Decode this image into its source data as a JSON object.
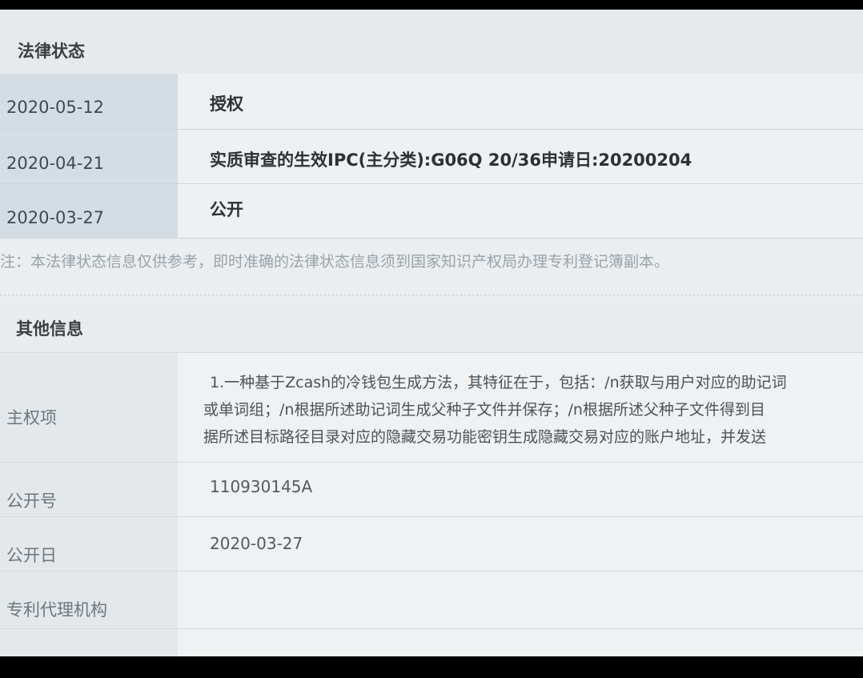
{
  "legal_status": {
    "title": "法律状态",
    "rows": [
      {
        "date": "2020-05-12",
        "status": "授权"
      },
      {
        "date": "2020-04-21",
        "status": "实质审查的生效IPC(主分类):G06Q 20/36申请日:20200204"
      },
      {
        "date": "2020-03-27",
        "status": "公开"
      }
    ],
    "note": "注：本法律状态信息仅供参考，即时准确的法律状态信息须到国家知识产权局办理专利登记簿副本。"
  },
  "other_info": {
    "title": "其他信息",
    "main_claim_label": "主权项",
    "main_claim_lines": [
      "1.一种基于Zcash的冷钱包生成方法，其特征在于，包括：/n获取与用户对应的助记词",
      "或单词组；/n根据所述助记词生成父种子文件并保存；/n根据所述父种子文件得到目",
      "据所述目标路径目录对应的隐藏交易功能密钥生成隐藏交易对应的账户地址，并发送"
    ],
    "pub_no_label": "公开号",
    "pub_no": "110930145A",
    "pub_date_label": "公开日",
    "pub_date": "2020-03-27",
    "agency_label": "专利代理机构",
    "agency": ""
  }
}
